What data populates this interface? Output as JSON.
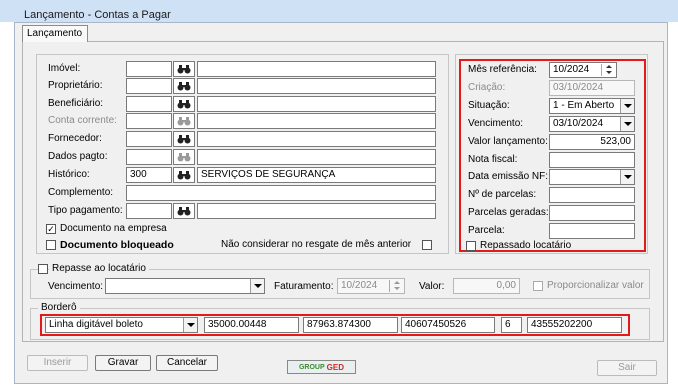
{
  "window": {
    "title": "Lançamento - Contas a Pagar"
  },
  "tabs": [
    {
      "label": "Lançamento"
    }
  ],
  "left": {
    "imovel": {
      "label": "Imóvel:"
    },
    "proprietario": {
      "label": "Proprietário:"
    },
    "beneficiario": {
      "label": "Beneficiário:"
    },
    "conta_corrente": {
      "label": "Conta corrente:"
    },
    "fornecedor": {
      "label": "Fornecedor:"
    },
    "dados_pagto": {
      "label": "Dados pagto:"
    },
    "historico": {
      "label": "Histórico:",
      "code": "300",
      "description": "SERVIÇOS DE SEGURANÇA"
    },
    "complemento": {
      "label": "Complemento:"
    },
    "tipo_pagamento": {
      "label": "Tipo pagamento:"
    },
    "documento_na_empresa": {
      "label": "Documento na empresa",
      "checked": true
    },
    "documento_bloqueado": {
      "label": "Documento bloqueado",
      "checked": false
    },
    "nao_considerar": {
      "label": "Não considerar no resgate de mês anterior",
      "checked": false
    }
  },
  "right": {
    "mes_referencia": {
      "label": "Mês referência:",
      "value": "10/2024"
    },
    "criacao": {
      "label": "Criação:",
      "value": "03/10/2024"
    },
    "situacao": {
      "label": "Situação:",
      "value": "1 - Em Aberto"
    },
    "vencimento": {
      "label": "Vencimento:",
      "value": "03/10/2024"
    },
    "valor_lancamento": {
      "label": "Valor lançamento:",
      "value": "523,00"
    },
    "nota_fiscal": {
      "label": "Nota fiscal:"
    },
    "data_emissao_nf": {
      "label": "Data emissão NF:"
    },
    "no_parcelas": {
      "label": "Nº de parcelas:"
    },
    "parcelas_geradas": {
      "label": "Parcelas geradas:"
    },
    "parcela": {
      "label": "Parcela:"
    },
    "repassado_locatario": {
      "label": "Repassado locatário",
      "checked": false
    }
  },
  "repasse": {
    "title": "Repasse ao locatário",
    "vencimento_label": "Vencimento:",
    "faturamento_label": "Faturamento:",
    "faturamento_value": "10/2024",
    "valor_label": "Valor:",
    "valor_value": "0,00",
    "proporcionalizar_label": "Proporcionalizar valor"
  },
  "bordero": {
    "title": "Borderô",
    "tipo": "Linha digitável boleto",
    "fields": [
      "35000.00448",
      "87963.874300",
      "40607450526",
      "6",
      "43555202200"
    ]
  },
  "buttons": {
    "inserir": "Inserir",
    "gravar": "Gravar",
    "cancelar": "Cancelar",
    "sair": "Sair"
  },
  "logo": {
    "group": "GROUP",
    "ged": "GED"
  },
  "colors": {
    "highlight": "#e21a1a",
    "logo_green": "#3b8a2e",
    "logo_red": "#d12a1f"
  }
}
